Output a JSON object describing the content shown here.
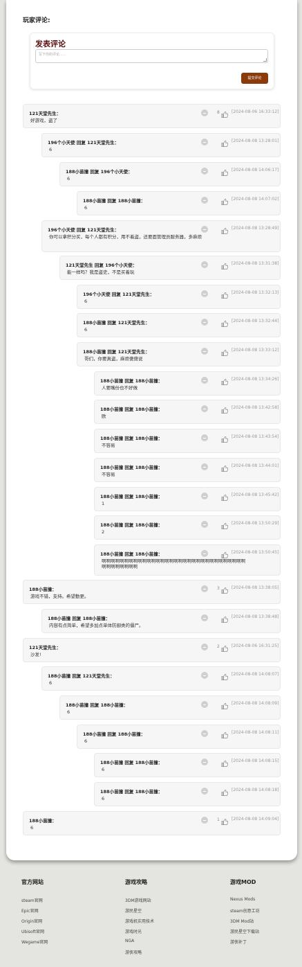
{
  "section_title": "玩家评论:",
  "post": {
    "title": "发表评论",
    "placeholder": "写下你的评论......",
    "submit_label": "提交评论"
  },
  "comments": [
    {
      "head": "121天堂先生：",
      "text": "好游戏，盗了",
      "count": "8",
      "date": "[2024-08-06 16:33:12]"
    },
    {
      "head": "196个小天使  回复  121天堂先生：",
      "text": "6",
      "count": "",
      "date": "[2024-08-08 13:28:01]"
    },
    {
      "head": "188小苗撞  回复  196个小天使：",
      "text": "6",
      "count": "",
      "date": "[2024-08-08 14:06:17]"
    },
    {
      "head": "188小苗撞  回复  188小苗撞：",
      "text": "6",
      "count": "",
      "date": "[2024-08-08 14:07:02]"
    },
    {
      "head": "196个小天使  回复  121天堂先生：",
      "text": "你可以拿积分买，每个人都有积分，用不着盗，还要面管理员服务器，多麻烦",
      "count": "",
      "date": "[2024-08-08 13:28:49]"
    },
    {
      "head": "121天堂先生  回复  196个小天使：",
      "text": "能一样吗？我是盗史，不是买着玩",
      "count": "",
      "date": "[2024-08-08 13:31:38]"
    },
    {
      "head": "196个小天使  回复  121天堂先生：",
      "text": "6",
      "count": "",
      "date": "[2024-08-08 13:32:13]"
    },
    {
      "head": "188小苗撞  回复  121天堂先生：",
      "text": "6",
      "count": "",
      "date": "[2024-08-08 13:32:44]"
    },
    {
      "head": "188小苗撞  回复  121天堂先生：",
      "text": "哥们，你要真盗，麻烦傻傻说",
      "count": "",
      "date": "[2024-08-08 13:33:12]"
    },
    {
      "head": "188小苗撞  回复  188小苗撞：",
      "text": "人要嘴份也不好做",
      "count": "",
      "date": "[2024-08-08 13:34:26]"
    },
    {
      "head": "188小苗撞  回复  188小苗撞：",
      "text": "欧",
      "count": "",
      "date": "[2024-08-08 13:42:58]"
    },
    {
      "head": "188小苗撞  回复  188小苗撞：",
      "text": "不容易",
      "count": "",
      "date": "[2024-08-08 13:43:54]"
    },
    {
      "head": "188小苗撞  回复  188小苗撞：",
      "text": "不容易",
      "count": "",
      "date": "[2024-08-08 13:44:01]"
    },
    {
      "head": "188小苗撞  回复  188小苗撞：",
      "text": "1",
      "count": "",
      "date": "[2024-08-08 13:45:42]"
    },
    {
      "head": "188小苗撞  回复  188小苗撞：",
      "text": "2",
      "count": "",
      "date": "[2024-08-08 13:50:29]"
    },
    {
      "head": "188小苗撞  回复  188小苗撞：",
      "text": "啊啊啊啊啊啊啊啊啊啊啊啊啊啊啊啊啊啊啊啊啊啊啊啊啊啊啊啊啊啊啊啊啊啊啊啊啊啊啊啊",
      "count": "",
      "date": "[2024-08-08 13:50:45]"
    },
    {
      "head": "188小苗撞：",
      "text": "游戏不错，支持。希望勤更。",
      "count": "3",
      "date": "[2024-08-08 13:38:05]"
    },
    {
      "head": "188小苗撞  回复  188小苗撞：",
      "text": "内容有点简单，希望多加点单体防御类的僵尸。",
      "count": "",
      "date": "[2024-08-08 13:38:48]"
    },
    {
      "head": "121天堂先生：",
      "text": "沙发!",
      "count": "2",
      "date": "[2024-08-06 16:31:25]"
    },
    {
      "head": "188小苗撞  回复  121天堂先生：",
      "text": "6",
      "count": "",
      "date": "[2024-08-08 14:08:07]"
    },
    {
      "head": "188小苗撞  回复  188小苗撞：",
      "text": "6",
      "count": "",
      "date": "[2024-08-08 14:08:09]"
    },
    {
      "head": "188小苗撞  回复  188小苗撞：",
      "text": "6",
      "count": "",
      "date": "[2024-08-08 14:08:11]"
    },
    {
      "head": "188小苗撞  回复  188小苗撞：",
      "text": "6",
      "count": "",
      "date": "[2024-08-08 14:08:15]"
    },
    {
      "head": "188小苗撞  回复  188小苗撞：",
      "text": "6",
      "count": "",
      "date": "[2024-08-08 14:08:18]"
    },
    {
      "head": "188小苗撞：",
      "text": "6",
      "count": "1",
      "date": "[2024-08-08 14:09:04]"
    }
  ],
  "footer": [
    {
      "title": "官方网站",
      "links": [
        "steam官网",
        "Epic官网",
        "Origin官网",
        "Ubisoft官网",
        "Wegame官网"
      ]
    },
    {
      "title": "游戏攻略",
      "links": [
        "3DM游戏网站",
        "游民星空",
        "游戏机实用技术",
        "游戏时光",
        "NGA",
        "游侠攻略"
      ]
    },
    {
      "title": "游戏MOD",
      "links": [
        "Nexus Mods",
        "steam创意工坊",
        "3DM Mod站",
        "游民星空下载站",
        "游侠补丁"
      ]
    }
  ],
  "colors": {
    "accent": "#8b3a0a",
    "title_red": "#5a0f0f",
    "page_bg": "#e4e5e0"
  }
}
